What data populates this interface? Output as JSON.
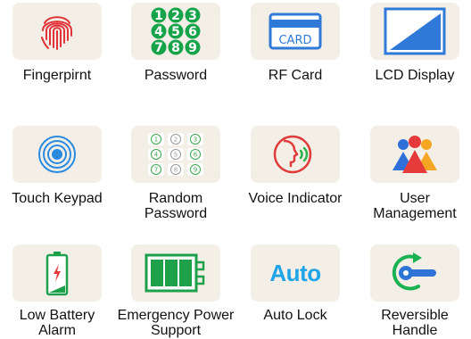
{
  "features": [
    {
      "label": "Fingerpirnt",
      "icon": "fingerprint-icon"
    },
    {
      "label": "Password",
      "icon": "number-keypad-icon",
      "digits": [
        "1",
        "2",
        "3",
        "4",
        "5",
        "6",
        "7",
        "8",
        "9"
      ]
    },
    {
      "label": "RF Card",
      "icon": "rf-card-icon",
      "card_text": "CARD"
    },
    {
      "label": "LCD Display",
      "icon": "lcd-display-icon"
    },
    {
      "label": "Touch Keypad",
      "icon": "touch-rings-icon"
    },
    {
      "label": "Random\nPassword",
      "icon": "random-keypad-icon",
      "digits": [
        "1",
        "2",
        "3",
        "4",
        "5",
        "6",
        "7",
        "8",
        "9"
      ]
    },
    {
      "label": "Voice Indicator",
      "icon": "voice-face-icon"
    },
    {
      "label": "User\nManagement",
      "icon": "users-group-icon"
    },
    {
      "label": "Low Battery\nAlarm",
      "icon": "battery-low-icon"
    },
    {
      "label": "Emergency Power\nSupport",
      "icon": "power-bank-icon"
    },
    {
      "label": "Auto Lock",
      "icon": "auto-text-icon",
      "icon_text": "Auto"
    },
    {
      "label": "Reversible\nHandle",
      "icon": "reversible-handle-icon"
    }
  ],
  "colors": {
    "tile_bg": "#f3efe6",
    "fingerprint": "#e2323a",
    "keypad_green": "#16a34a",
    "card_blue": "#2f7ad8",
    "touch_blue": "#2c8ae3",
    "random_green": "#3aa64a",
    "voice_red": "#e03a3a",
    "voice_green": "#2bb24c",
    "users_red": "#e63b3b",
    "users_orange": "#f5a623",
    "users_blue": "#2f6fd8",
    "battery_green": "#1ea04b",
    "auto_blue": "#1fa4e8",
    "handle_green": "#1ab253",
    "handle_blue": "#2d74d6"
  }
}
